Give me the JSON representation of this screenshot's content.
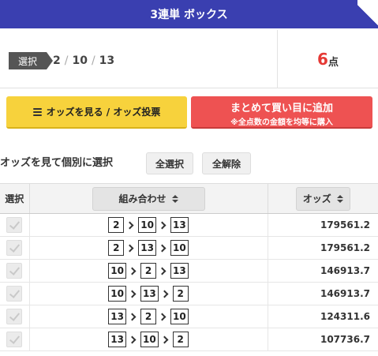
{
  "header": {
    "title": "3連単 ボックス"
  },
  "selection": {
    "tag": "選択",
    "numbers": [
      "2",
      "10",
      "13"
    ],
    "points_value": "6",
    "points_unit": "点"
  },
  "actions": {
    "odds_button": "オッズを見る / オッズ投票",
    "bulk_button_main": "まとめて買い目に追加",
    "bulk_button_sub": "※全点数の金額を均等に購入"
  },
  "individual": {
    "label": "オッズを見て個別に選択",
    "select_all": "全選択",
    "clear_all": "全解除"
  },
  "table": {
    "headers": {
      "select": "選択",
      "combination": "組み合わせ",
      "odds": "オッズ"
    },
    "rows": [
      {
        "combo": [
          "2",
          "10",
          "13"
        ],
        "odds": "179561.2"
      },
      {
        "combo": [
          "2",
          "13",
          "10"
        ],
        "odds": "179561.2"
      },
      {
        "combo": [
          "10",
          "2",
          "13"
        ],
        "odds": "146913.7"
      },
      {
        "combo": [
          "10",
          "13",
          "2"
        ],
        "odds": "146913.7"
      },
      {
        "combo": [
          "13",
          "2",
          "10"
        ],
        "odds": "124311.6"
      },
      {
        "combo": [
          "13",
          "10",
          "2"
        ],
        "odds": "107736.7"
      }
    ]
  },
  "colors": {
    "header_bg": "#3a3fb0",
    "odds_button": "#f7d23c",
    "bulk_button": "#ee5252",
    "points": "#e53935"
  }
}
